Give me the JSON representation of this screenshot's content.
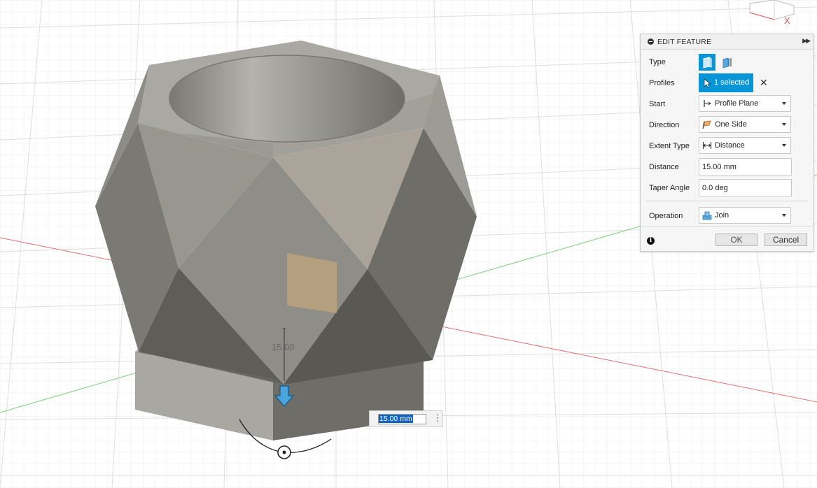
{
  "viewcube": {
    "axis_label": "X"
  },
  "canvas": {
    "dimension_text": "15.00"
  },
  "value_input": {
    "value": "15.00 mm",
    "menu_icon": "more-vertical-icon"
  },
  "edit_feature": {
    "title": "EDIT FEATURE",
    "type": {
      "label": "Type"
    },
    "profiles": {
      "label": "Profiles",
      "selection": "1 selected"
    },
    "start": {
      "label": "Start",
      "value": "Profile Plane"
    },
    "direction": {
      "label": "Direction",
      "value": "One Side"
    },
    "extent_type": {
      "label": "Extent Type",
      "value": "Distance"
    },
    "distance": {
      "label": "Distance",
      "value": "15.00 mm"
    },
    "taper_angle": {
      "label": "Taper Angle",
      "value": "0.0 deg"
    },
    "operation": {
      "label": "Operation",
      "value": "Join"
    },
    "ok_label": "OK",
    "cancel_label": "Cancel"
  },
  "colors": {
    "accent": "#0696d7",
    "x_axis": "#e05050",
    "y_axis": "#50c050",
    "model_gray": "#8c8a84"
  }
}
